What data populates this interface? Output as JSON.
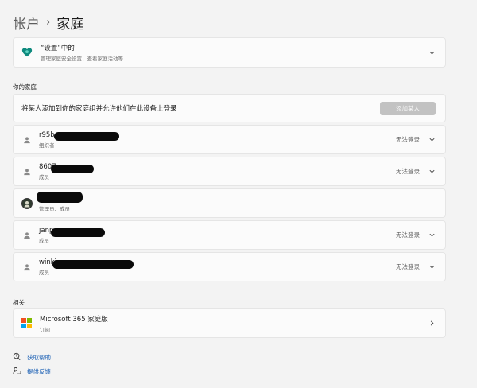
{
  "breadcrumb": {
    "parent": "帐户",
    "separator": "›",
    "current": "家庭"
  },
  "settings_card": {
    "title": "“设置”中的",
    "subtitle": "管理家庭安全设置、查看家庭活动等"
  },
  "family_section": {
    "label": "你的家庭",
    "add_prompt": "将某人添加到你的家庭组并允许他们在此设备上登录",
    "add_button": "添加某人",
    "members": [
      {
        "name": "r95b",
        "role": "组织者",
        "status": "无法登录",
        "avatar": "person-icon"
      },
      {
        "name": "8607",
        "role": "成员",
        "status": "无法登录",
        "avatar": "person-icon"
      },
      {
        "name": "",
        "role": "管理员、成员",
        "status": "",
        "avatar": "photo-avatar"
      },
      {
        "name": "janp",
        "role": "成员",
        "status": "无法登录",
        "avatar": "person-icon"
      },
      {
        "name": "winki",
        "role": "成员",
        "status": "无法登录",
        "avatar": "person-icon"
      }
    ]
  },
  "related_section": {
    "label": "相关",
    "item_title": "Microsoft 365 家庭版",
    "item_subtitle": "订阅"
  },
  "links": {
    "help": "获取帮助",
    "feedback": "提供反馈"
  },
  "colors": {
    "accent_link": "#1a5fb4",
    "disabled_button": "#c2c2c2",
    "background": "#f3f3f3",
    "card": "#fbfbfb"
  }
}
